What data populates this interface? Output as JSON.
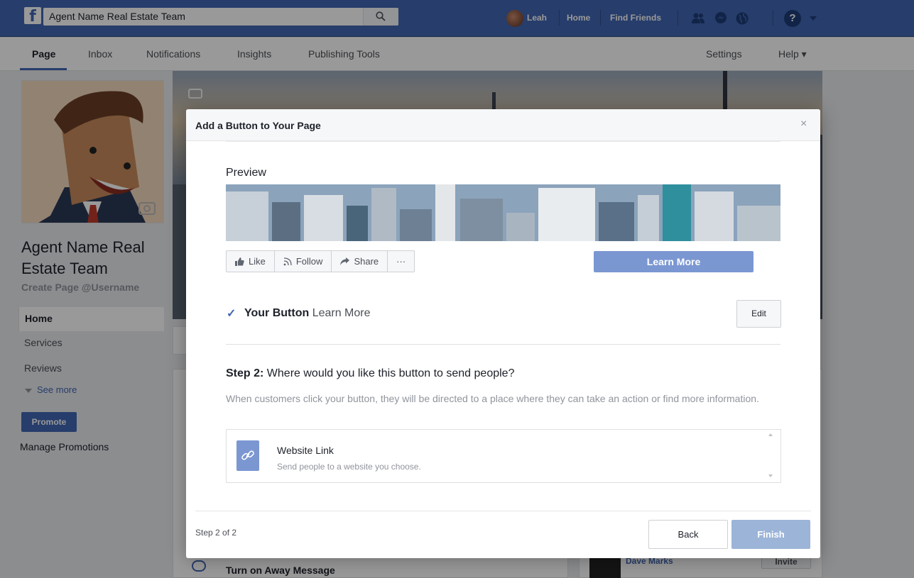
{
  "topbar": {
    "search_value": "Agent Name Real Estate Team",
    "user_name": "Leah",
    "home": "Home",
    "find_friends": "Find Friends",
    "help_icon_glyph": "?"
  },
  "tabs": [
    "Page",
    "Inbox",
    "Notifications",
    "Insights",
    "Publishing Tools"
  ],
  "tabs_right": {
    "settings": "Settings",
    "help": "Help ▾"
  },
  "left": {
    "page_name": "Agent Name Real Estate Team",
    "username_link": "Create Page @Username",
    "nav": [
      "Home",
      "Services",
      "Reviews"
    ],
    "see_more": "See more",
    "promote": "Promote",
    "manage_promotions": "Manage Promotions"
  },
  "background": {
    "away_message": "Turn on Away Message",
    "friend_name": "Dave Marks",
    "invite": "Invite"
  },
  "modal": {
    "title": "Add a Button to Your Page",
    "close": "×",
    "preview_label": "Preview",
    "actions": {
      "like": "Like",
      "follow": "Follow",
      "share": "Share",
      "more": "···"
    },
    "cta_preview": "Learn More",
    "your_button_label": "Your Button",
    "your_button_value": "Learn More",
    "edit": "Edit",
    "step_label": "Step 2:",
    "step_question": "Where would you like this button to send people?",
    "step_description": "When customers click your button, they will be directed to a place where they can take an action or find more information.",
    "option": {
      "title": "Website Link",
      "subtitle": "Send people to a website you choose."
    },
    "footer": {
      "step_count": "Step 2 of 2",
      "back": "Back",
      "finish": "Finish"
    }
  },
  "colors": {
    "brand": "#4267b2",
    "cta": "#7b97d2",
    "finish_disabled": "#9cb4d8"
  }
}
